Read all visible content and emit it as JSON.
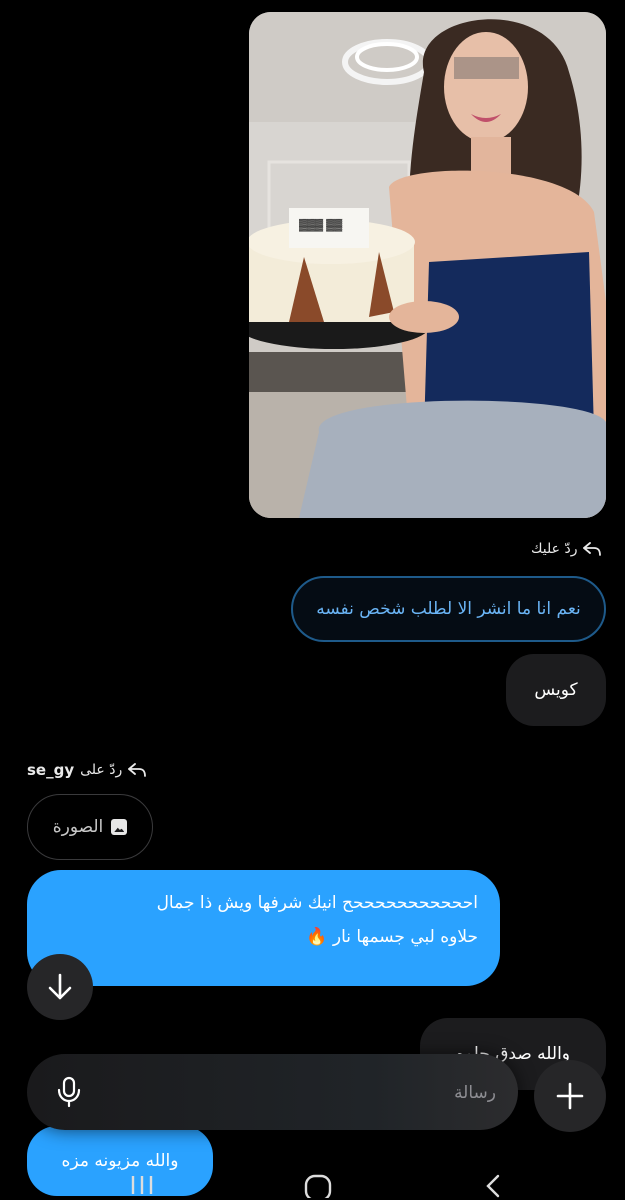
{
  "messages": {
    "photo_alt": "photo message",
    "reply_to_you_label": "ردّ عليك",
    "quoted_text": "نعم انا ما انشر الا لطلب شخص نفسه",
    "reply_good": "كويس",
    "reply_to_user_label": "ردّ على",
    "reply_to_user_name": "se_gy",
    "quoted_image_label": "الصورة",
    "long_message_line1": "احححححححححححح انيك شرفها ويش ذا جمال",
    "long_message_line2": "حلاوه لبي جسمها نار 🔥",
    "partial_message": "والله صدق حلوه",
    "last_message": "والله مزيونه مزه"
  },
  "composer": {
    "placeholder": "رسالة"
  },
  "colors": {
    "accent": "#2aa2ff",
    "quoted_border": "#1e5a8a",
    "bubble_gray": "#1c1c1e"
  },
  "icons": {
    "reply": "reply-arrow-icon",
    "image": "image-icon",
    "scroll": "arrow-down-icon",
    "mic": "microphone-icon",
    "plus": "plus-icon",
    "nav_recents": "recents-icon",
    "nav_home": "home-icon",
    "nav_back": "back-icon"
  }
}
